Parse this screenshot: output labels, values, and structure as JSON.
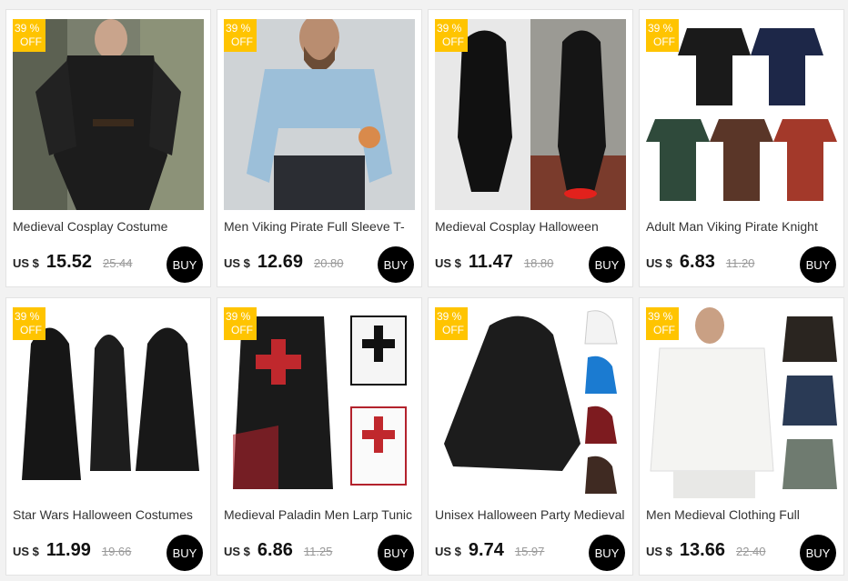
{
  "products": [
    {
      "title": "Medieval Cosplay Costume",
      "currency": "US $",
      "price": "15.52",
      "old_price": "25.44",
      "badge_pct": "39 %",
      "badge_off": "OFF",
      "buy": "BUY",
      "image": "black-laced-shirt-photo"
    },
    {
      "title": "Men Viking Pirate Full Sleeve T-",
      "currency": "US $",
      "price": "12.69",
      "old_price": "20.80",
      "badge_pct": "39 %",
      "badge_off": "OFF",
      "buy": "BUY",
      "image": "light-blue-shirt-photo"
    },
    {
      "title": "Medieval Cosplay Halloween",
      "currency": "US $",
      "price": "11.47",
      "old_price": "18.80",
      "badge_pct": "39 %",
      "badge_off": "OFF",
      "buy": "BUY",
      "image": "hooded-black-coat-photo"
    },
    {
      "title": "Adult Man Viking Pirate Knight",
      "currency": "US $",
      "price": "6.83",
      "old_price": "11.20",
      "badge_pct": "39 %",
      "badge_off": "OFF",
      "buy": "BUY",
      "image": "viking-tunics-photo"
    },
    {
      "title": "Star Wars Halloween Costumes",
      "currency": "US $",
      "price": "11.99",
      "old_price": "19.66",
      "badge_pct": "39 %",
      "badge_off": "OFF",
      "buy": "BUY",
      "image": "black-robes-photo"
    },
    {
      "title": "Medieval Paladin Men Larp Tunic",
      "currency": "US $",
      "price": "6.86",
      "old_price": "11.25",
      "badge_pct": "39 %",
      "badge_off": "OFF",
      "buy": "BUY",
      "image": "templar-tunics-photo"
    },
    {
      "title": "Unisex Halloween Party Medieval",
      "currency": "US $",
      "price": "9.74",
      "old_price": "15.97",
      "badge_pct": "39 %",
      "badge_off": "OFF",
      "buy": "BUY",
      "image": "hooded-capes-photo"
    },
    {
      "title": "Men Medieval Clothing Full",
      "currency": "US $",
      "price": "13.66",
      "old_price": "22.40",
      "badge_pct": "39 %",
      "badge_off": "OFF",
      "buy": "BUY",
      "image": "white-shirts-photo"
    }
  ],
  "colors": {
    "badge": "#ffc400",
    "buy_button": "#000000"
  }
}
